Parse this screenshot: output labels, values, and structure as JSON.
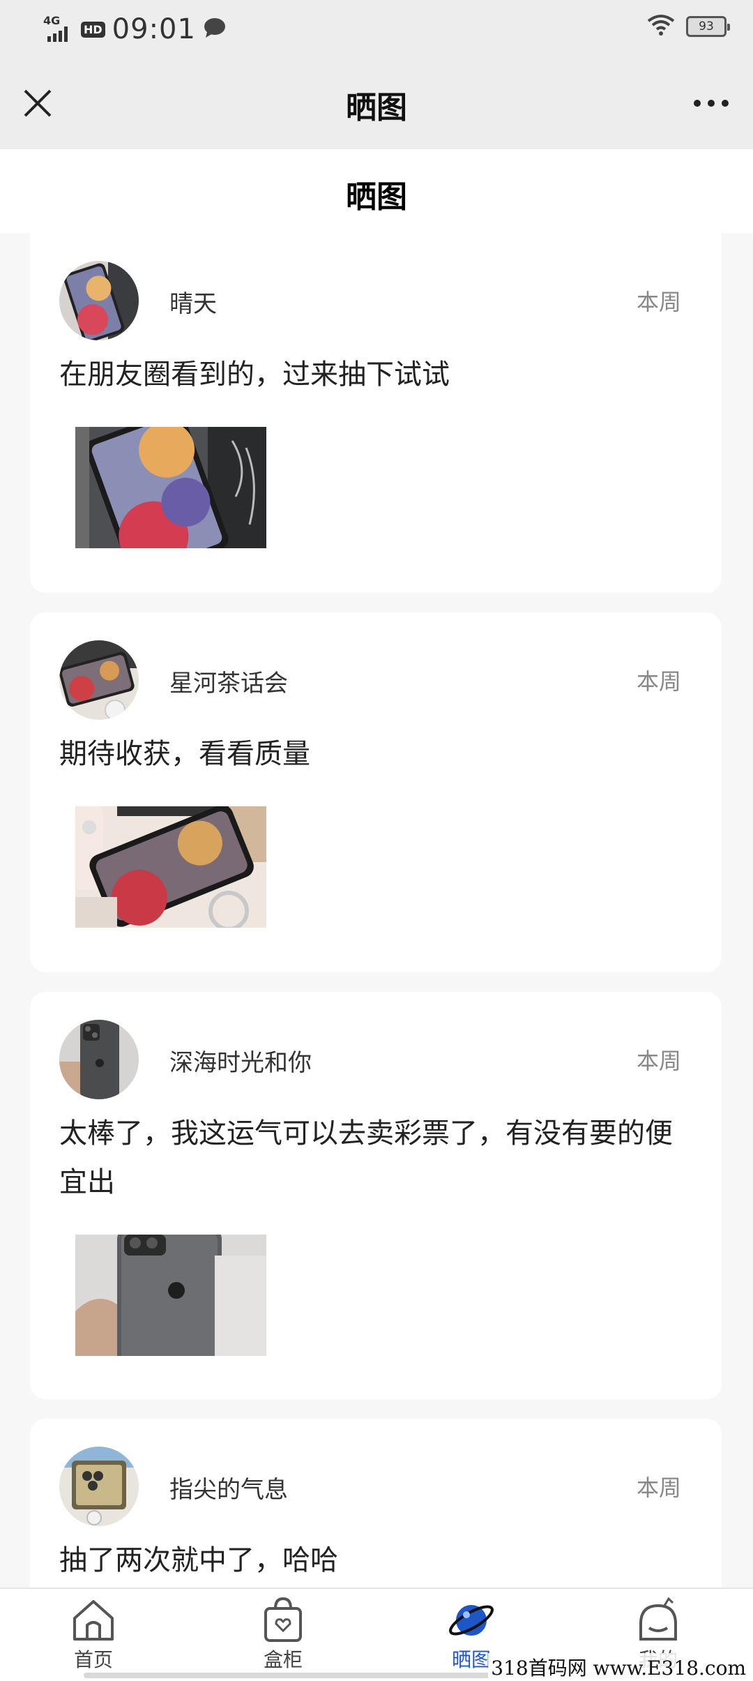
{
  "status_bar": {
    "network": "4G",
    "hd": "HD",
    "time": "09:01",
    "battery": "93"
  },
  "nav": {
    "title": "晒图"
  },
  "page": {
    "header": "晒图"
  },
  "posts": [
    {
      "user": "晴天",
      "time": "本周",
      "content": "在朋友圈看到的，过来抽下试试",
      "avatar_icon": "phone-photo-icon",
      "photo_icon": "phone-photo-icon"
    },
    {
      "user": "星河茶话会",
      "time": "本周",
      "content": "期待收获，看看质量",
      "avatar_icon": "phone-photo-icon",
      "photo_icon": "phone-photo-icon"
    },
    {
      "user": "深海时光和你",
      "time": "本周",
      "content": "太棒了，我这运气可以去卖彩票了，有没有要的便宜出",
      "avatar_icon": "phone-back-photo-icon",
      "photo_icon": "phone-back-photo-icon"
    },
    {
      "user": "指尖的气息",
      "time": "本周",
      "content": "抽了两次就中了，哈哈",
      "avatar_icon": "phone-box-photo-icon"
    }
  ],
  "tabs": [
    {
      "label": "首页",
      "icon": "home-icon",
      "active": false
    },
    {
      "label": "盒柜",
      "icon": "bag-icon",
      "active": false
    },
    {
      "label": "晒图",
      "icon": "planet-icon",
      "active": true
    },
    {
      "label": "我的",
      "icon": "profile-icon",
      "active": false
    }
  ],
  "watermark": "318首码网 www.E318.com",
  "colors": {
    "accent": "#1f56c7",
    "nav_bg": "#ededed",
    "page_bg": "#f7f7f7"
  }
}
